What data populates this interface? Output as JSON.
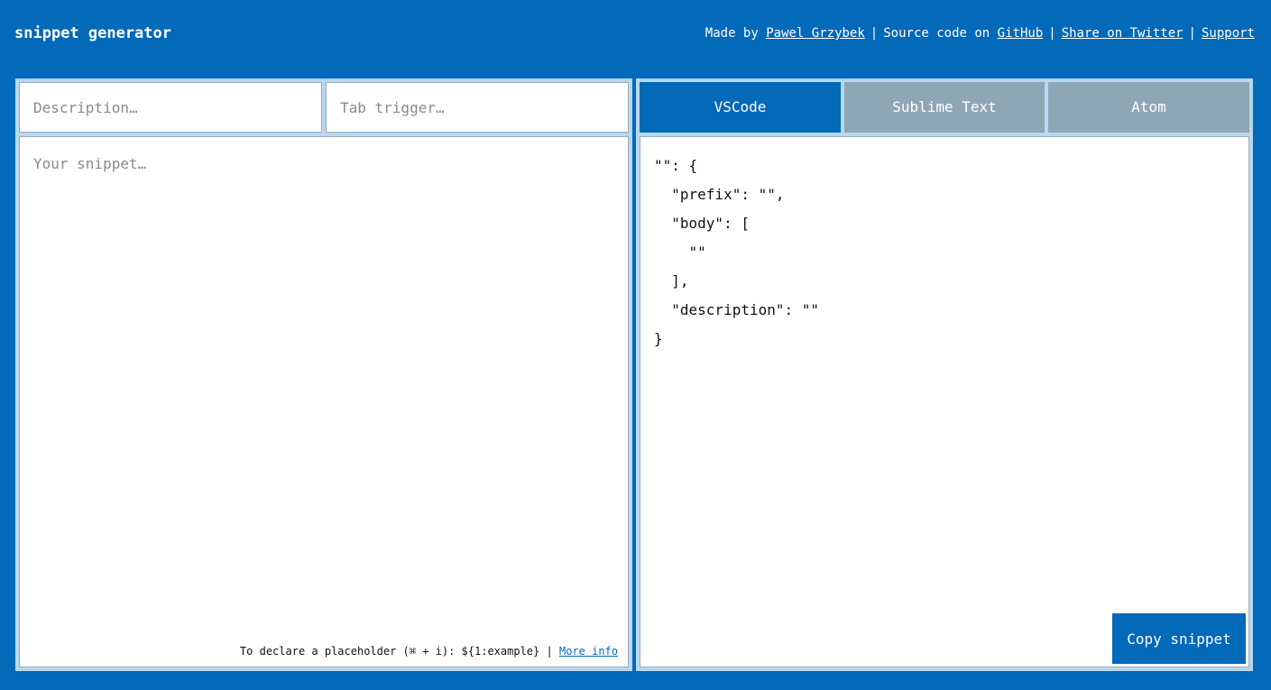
{
  "header": {
    "title": "snippet generator",
    "made_by_prefix": "Made by ",
    "author": "Pawel Grzybek",
    "source_prefix": "Source code on ",
    "github": "GitHub",
    "twitter": "Share on Twitter",
    "support": "Support",
    "separator": "|"
  },
  "inputs": {
    "description_placeholder": "Description…",
    "description_value": "",
    "trigger_placeholder": "Tab trigger…",
    "trigger_value": "",
    "snippet_placeholder": "Your snippet…",
    "snippet_value": ""
  },
  "hint": {
    "text": "To declare a placeholder (⌘ + i): ${1:example}",
    "separator": "|",
    "link": "More info"
  },
  "tabs": [
    {
      "label": "VSCode",
      "active": true
    },
    {
      "label": "Sublime Text",
      "active": false
    },
    {
      "label": "Atom",
      "active": false
    }
  ],
  "output": {
    "code": "\"\": {\n  \"prefix\": \"\",\n  \"body\": [\n    \"\"\n  ],\n  \"description\": \"\"\n}"
  },
  "copy_button": "Copy snippet",
  "colors": {
    "brand": "#0369b9",
    "panel": "#b8d8ef",
    "inactive_tab": "#8fa6b5"
  }
}
